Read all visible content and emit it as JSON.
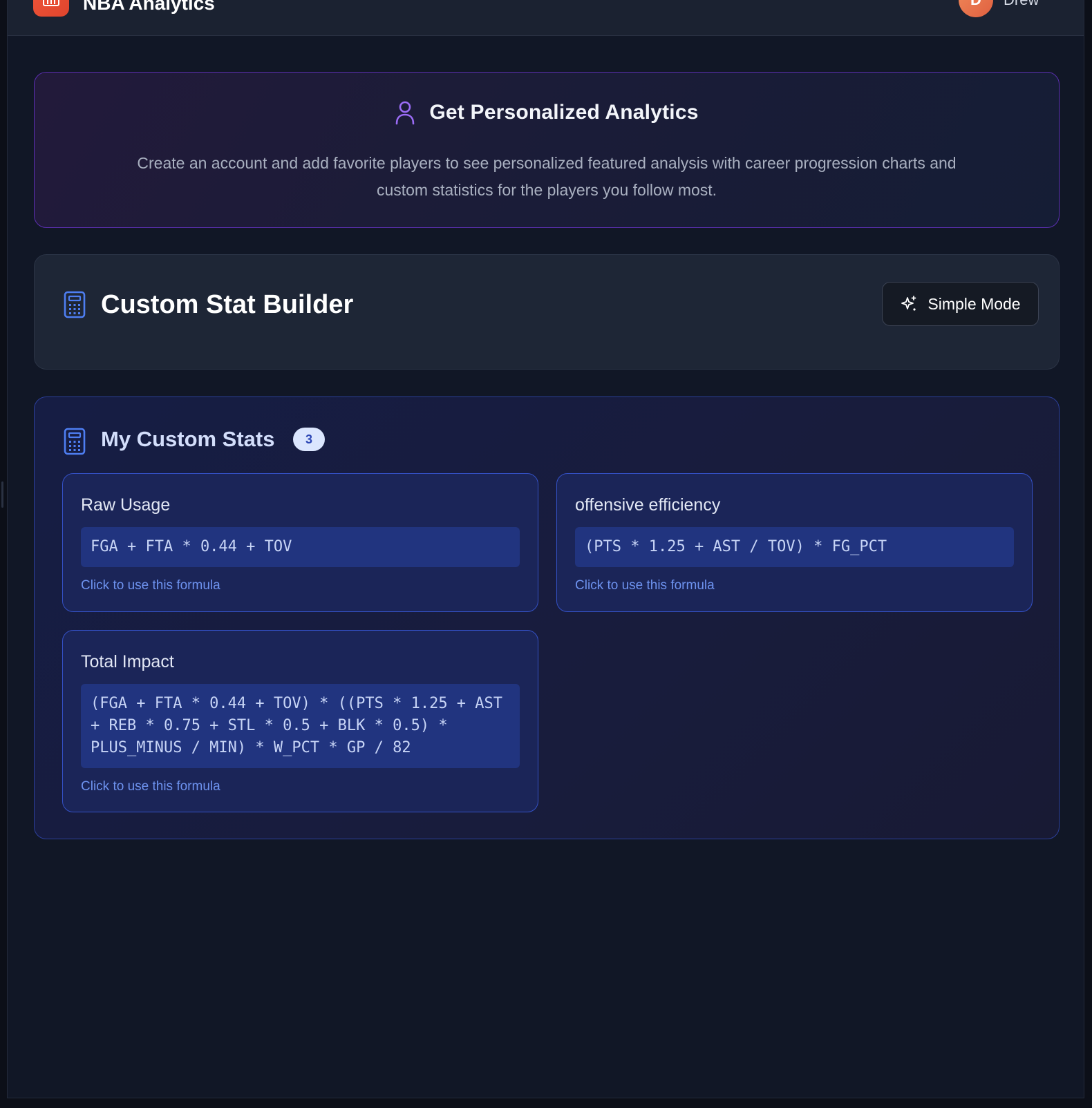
{
  "header": {
    "app_title": "NBA Analytics",
    "user_initial": "D",
    "user_name": "Drew"
  },
  "promo": {
    "title": "Get Personalized Analytics",
    "text": "Create an account and add favorite players to see personalized featured analysis with career progression charts and custom statistics for the players you follow most.",
    "icon": "user-icon",
    "accent_color": "#8b5cf6"
  },
  "builder": {
    "title": "Custom Stat Builder",
    "icon": "calculator-icon",
    "mode_button_label": "Simple Mode",
    "mode_button_icon": "sparkles-icon"
  },
  "custom_stats": {
    "title": "My Custom Stats",
    "count": "3",
    "icon": "calculator-icon",
    "items": [
      {
        "name": "Raw Usage",
        "formula": "FGA + FTA * 0.44 + TOV",
        "hint": "Click to use this formula"
      },
      {
        "name": "offensive efficiency",
        "formula": "(PTS * 1.25 + AST / TOV) * FG_PCT",
        "hint": "Click to use this formula"
      },
      {
        "name": "Total Impact",
        "formula": "(FGA + FTA * 0.44 + TOV) * ((PTS * 1.25 + AST + REB * 0.75 + STL * 0.5 + BLK * 0.5) * PLUS_MINUS / MIN) * W_PCT * GP / 82",
        "hint": "Click to use this formula"
      }
    ]
  },
  "colors": {
    "background": "#111726",
    "card_accent": "#3451c6",
    "logo": "#f0563a",
    "link": "#6e93f0"
  }
}
